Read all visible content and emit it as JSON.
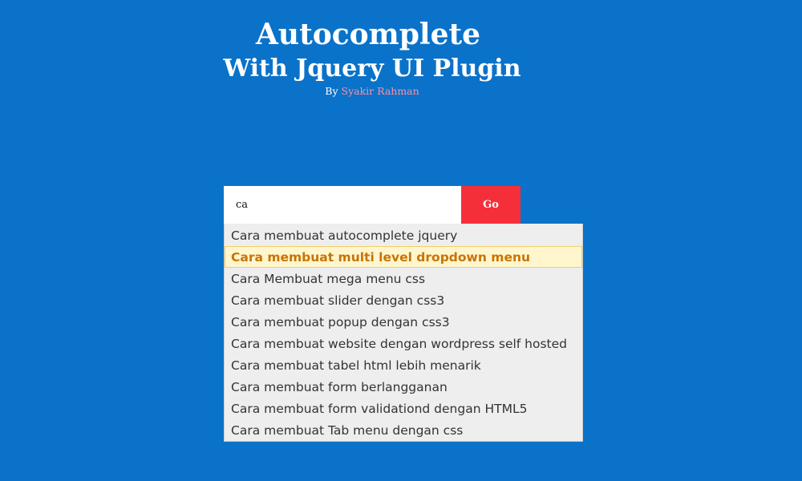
{
  "header": {
    "title_line1": "Autocomplete",
    "title_line2": "With Jquery UI Plugin",
    "byline_prefix": "By",
    "author": "Syakir Rahman"
  },
  "search": {
    "value": "ca",
    "placeholder": "",
    "button_label": "Go"
  },
  "suggestions": [
    {
      "label": "Cara membuat autocomplete jquery",
      "highlighted": false
    },
    {
      "label": "Cara membuat multi level dropdown menu",
      "highlighted": true
    },
    {
      "label": "Cara Membuat mega menu css",
      "highlighted": false
    },
    {
      "label": "Cara membuat slider dengan css3",
      "highlighted": false
    },
    {
      "label": "Cara membuat popup dengan css3",
      "highlighted": false
    },
    {
      "label": "Cara membuat website dengan wordpress self hosted",
      "highlighted": false
    },
    {
      "label": "Cara membuat tabel html lebih menarik",
      "highlighted": false
    },
    {
      "label": "Cara membuat form berlangganan",
      "highlighted": false
    },
    {
      "label": "Cara membuat form validationd dengan HTML5",
      "highlighted": false
    },
    {
      "label": "Cara membuat Tab menu dengan css",
      "highlighted": false
    }
  ],
  "colors": {
    "background": "#0a72c9",
    "go_button": "#f52f3a",
    "author_link": "#ff8fa3",
    "highlight_bg": "#fff6ce",
    "highlight_text": "#c77405"
  }
}
